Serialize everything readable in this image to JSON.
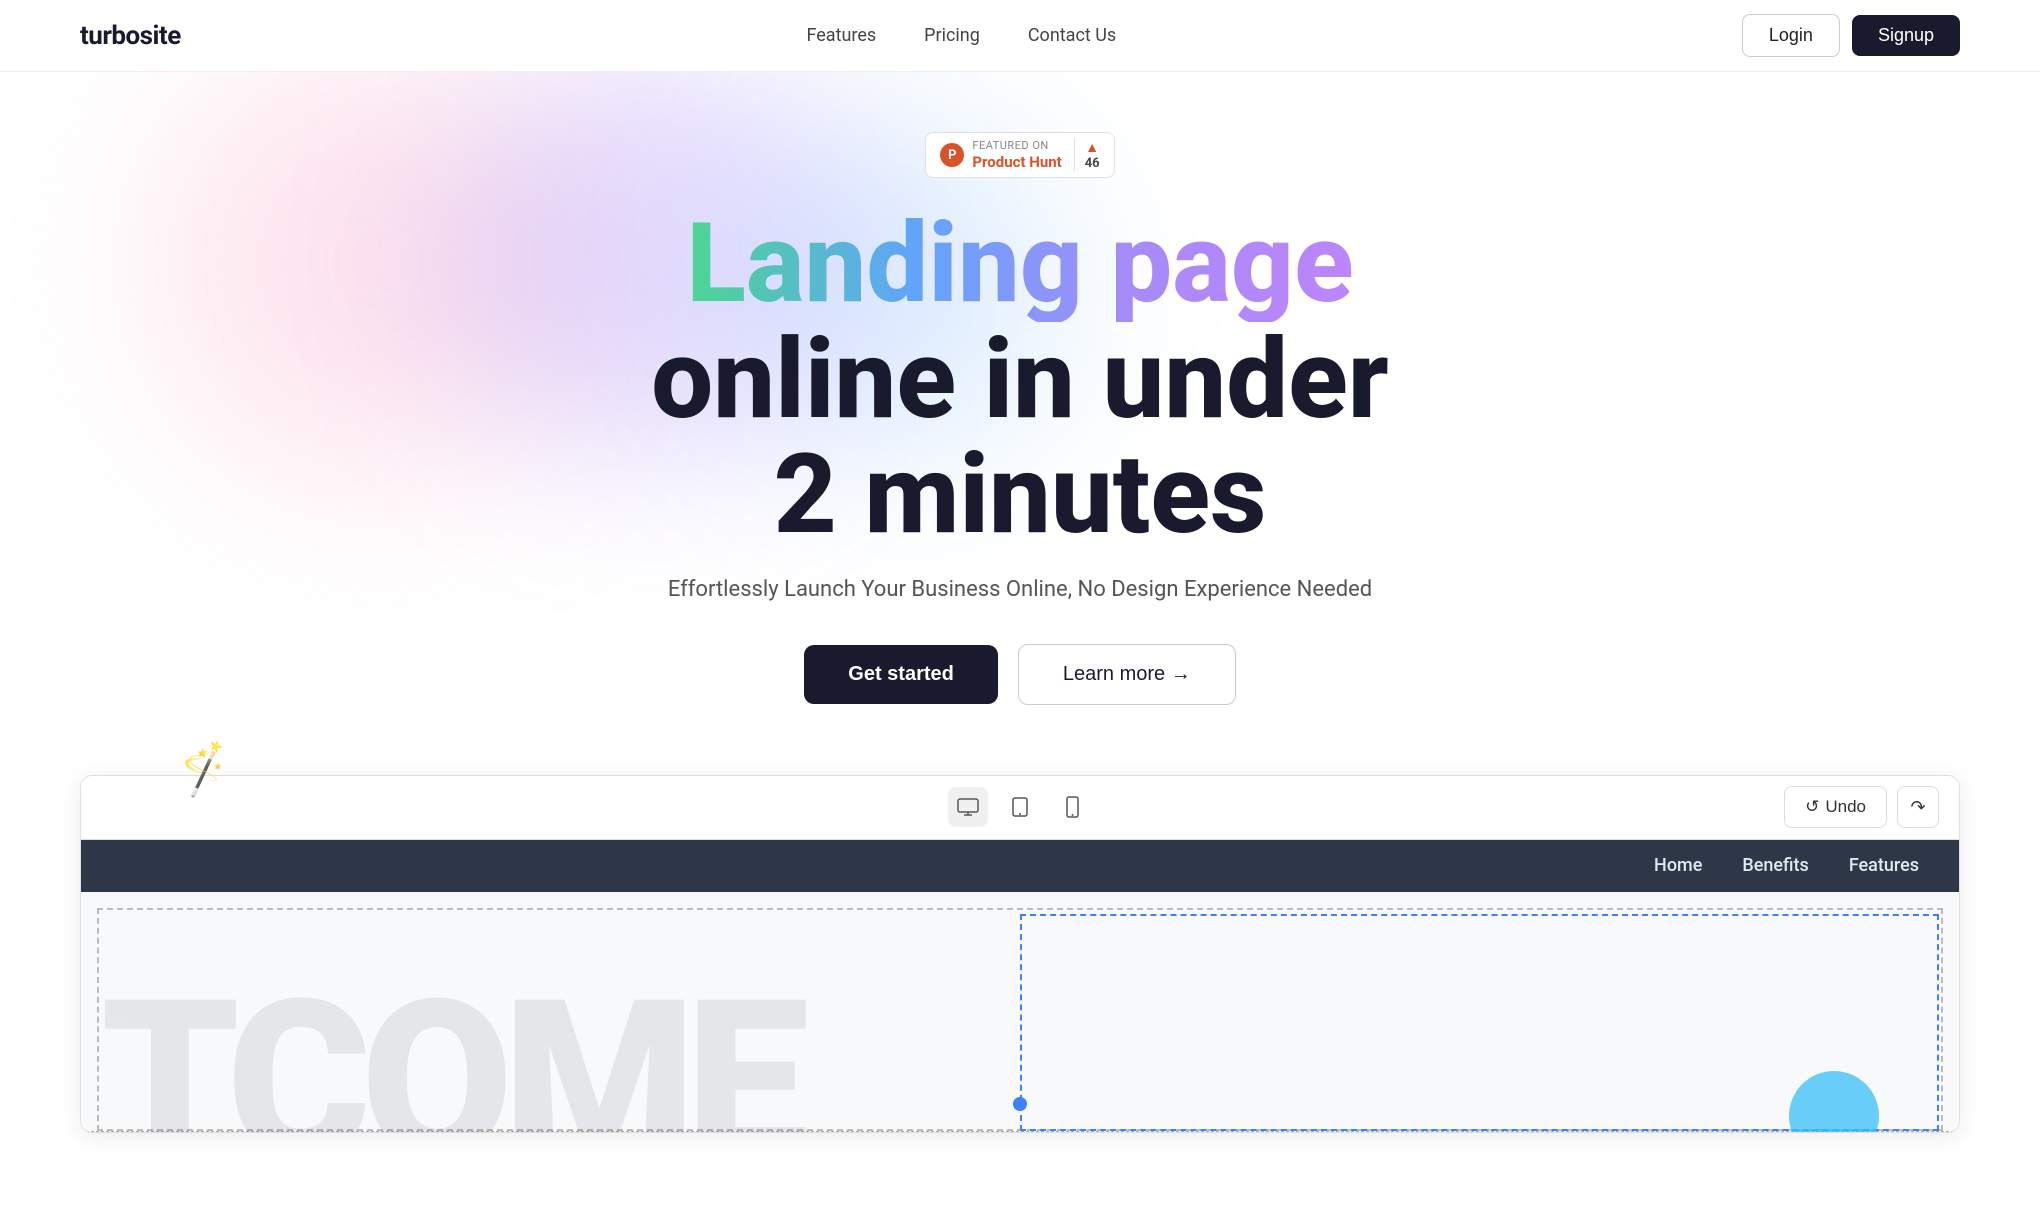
{
  "navbar": {
    "logo": "turbosite",
    "links": [
      {
        "label": "Features",
        "id": "features"
      },
      {
        "label": "Pricing",
        "id": "pricing"
      },
      {
        "label": "Contact Us",
        "id": "contact"
      }
    ],
    "login_label": "Login",
    "signup_label": "Signup"
  },
  "hero": {
    "product_hunt": {
      "small_text": "FEATURED ON",
      "brand": "Product Hunt",
      "score": "▲",
      "num": "46"
    },
    "heading_line1": "Landing page",
    "heading_line2": "online in under",
    "heading_line3": "2 minutes",
    "subtitle": "Effortlessly Launch Your Business Online, No Design Experience Needed",
    "cta_primary": "Get started",
    "cta_secondary": "Learn more →"
  },
  "editor": {
    "undo_label": "Undo",
    "redo_symbol": "↷",
    "undo_symbol": "↺",
    "device_icons": [
      "desktop",
      "tablet",
      "mobile"
    ],
    "preview_nav": [
      "Home",
      "Benefits",
      "Features"
    ],
    "big_text": "TCOME"
  },
  "icons": {
    "desktop": "🖥",
    "tablet": "⬛",
    "mobile": "📱",
    "wand": "✨🪄"
  }
}
